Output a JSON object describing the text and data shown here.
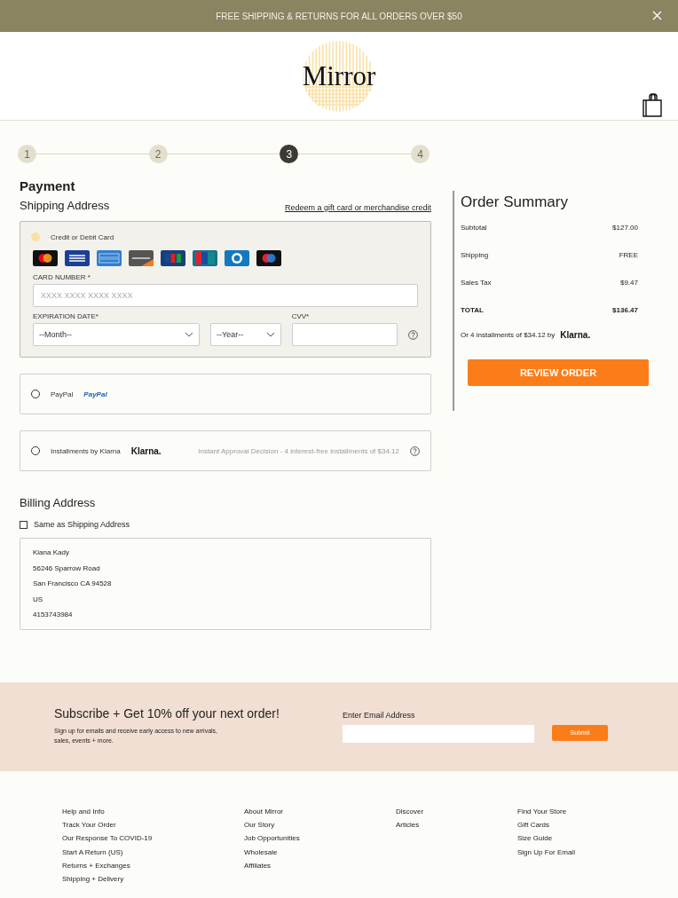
{
  "banner": {
    "text": "FREE SHIPPING & RETURNS FOR ALL ORDERS OVER $50"
  },
  "header": {
    "logo": "Mirror"
  },
  "steps": [
    {
      "label": "1",
      "selected": false
    },
    {
      "label": "2",
      "selected": false
    },
    {
      "label": "3",
      "selected": true
    },
    {
      "label": "4",
      "selected": false
    }
  ],
  "payment": {
    "title": "Payment",
    "subtitle": "Shipping Address",
    "redeem_link": "Redeem a gift card or merchandise credit",
    "methods": [
      {
        "kind": "card",
        "label": "Credit or Debit Card",
        "selected": true,
        "card_number_label": "CARD NUMBER *",
        "card_number_placeholder": "XXXX XXXX XXXX XXXX",
        "expiration_label": "EXPIRATION DATE*",
        "month": "--Month--",
        "year": "--Year--",
        "cvv_label": "CVV*"
      },
      {
        "kind": "paypal",
        "label": "PayPal",
        "logo": "PayPal",
        "selected": false
      },
      {
        "kind": "klarna",
        "label": "Installments by Klarna",
        "logo": "Klarna.",
        "note": "Instant Approval Decision - 4 interest-free installments of $34.12",
        "selected": false
      }
    ]
  },
  "billing": {
    "title": "Billing Address",
    "same_as_shipping": {
      "label": "Same as Shipping Address",
      "checked": false
    },
    "address": [
      "Kiana Kady",
      "56246 Sparrow Road",
      "San Francisco CA 94528",
      "US",
      "4153743984"
    ]
  },
  "summary": {
    "title": "Order Summary",
    "rows": [
      {
        "kind": "line",
        "label": "Subtotal",
        "value": "$127.00"
      },
      {
        "kind": "line",
        "label": "Shipping",
        "value": "FREE"
      },
      {
        "kind": "line",
        "label": "Sales Tax",
        "value": "$9.47"
      },
      {
        "kind": "total",
        "label": "TOTAL",
        "value": "$136.47"
      }
    ],
    "klarna_note": "Or 4 installments of $34.12 by",
    "klarna_logo": "Klarna.",
    "button": "REVIEW ORDER"
  },
  "subscribe": {
    "title": "Subscribe + Get 10% off your next order!",
    "text": "Sign up for emails and receive early access to new arrivals, sales, events + more.",
    "email_label": "Enter Email Address",
    "button": "Submit"
  },
  "footer": {
    "columns": [
      [
        "Help and Info",
        "Track Your Order",
        "Our Response To COVID-19",
        "Start A Return (US)",
        "Returns + Exchanges",
        "Shipping + Delivery"
      ],
      [
        "About Mirror",
        "Our Story",
        "Job Opportunities",
        "Wholesale",
        "Affiliates"
      ],
      [
        "Discover",
        "Articles"
      ],
      [
        "Find Your Store",
        "Gift Cards",
        "Size Guide",
        "Sign Up For Email"
      ]
    ]
  }
}
